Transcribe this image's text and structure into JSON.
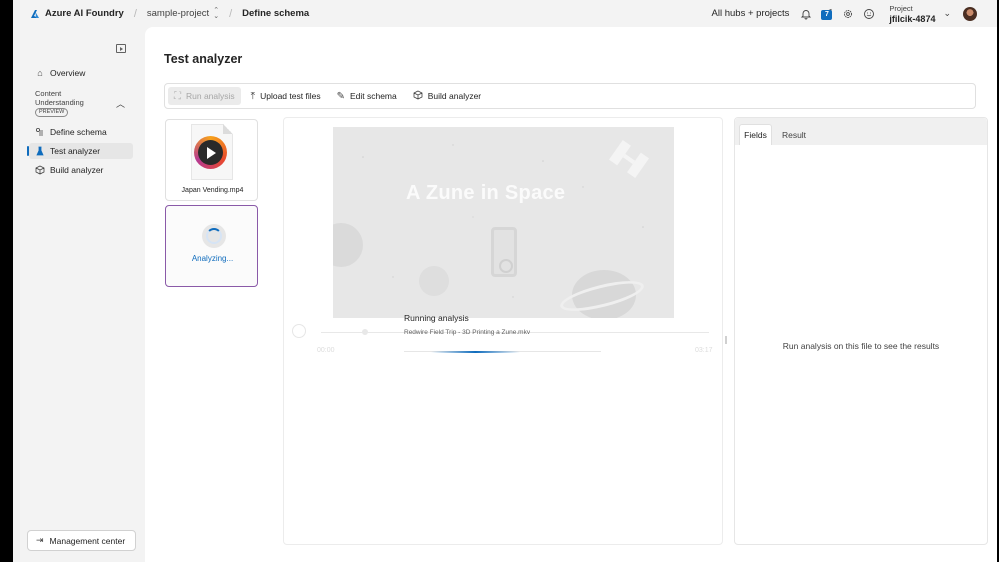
{
  "topbar": {
    "brand": "Azure AI Foundry",
    "project_crumb": "sample-project",
    "current_crumb": "Define schema",
    "hubs_link": "All hubs + projects",
    "notification_count": "7",
    "project_label": "Project",
    "project_name": "jfilcik-4874"
  },
  "sidebar": {
    "overview": "Overview",
    "section_title_line1": "Content",
    "section_title_line2": "Understanding",
    "preview_badge": "PREVIEW",
    "items": [
      {
        "label": "Define schema",
        "icon": "schema-icon"
      },
      {
        "label": "Test analyzer",
        "icon": "flask-icon",
        "active": true
      },
      {
        "label": "Build analyzer",
        "icon": "cube-icon"
      }
    ],
    "management": "Management center"
  },
  "main": {
    "title": "Test analyzer",
    "toolbar": {
      "run": "Run analysis",
      "upload": "Upload test files",
      "edit": "Edit schema",
      "build": "Build analyzer"
    },
    "files": [
      {
        "name": "Japan Vending.mp4",
        "status": ""
      },
      {
        "name": "",
        "status": "Analyzing..."
      }
    ],
    "preview": {
      "video_title": "A Zune in Space",
      "time_start": "00:00",
      "time_end": "03:17",
      "status": "Running analysis",
      "file": "Redwire Field Trip - 3D Printing a Zune.mkv",
      "progress": 0.45
    },
    "results": {
      "tabs": [
        "Fields",
        "Result"
      ],
      "empty_message": "Run analysis on this file to see the results"
    }
  },
  "colors": {
    "accent": "#0f6cbd",
    "selected_border": "#8a5aa8"
  }
}
